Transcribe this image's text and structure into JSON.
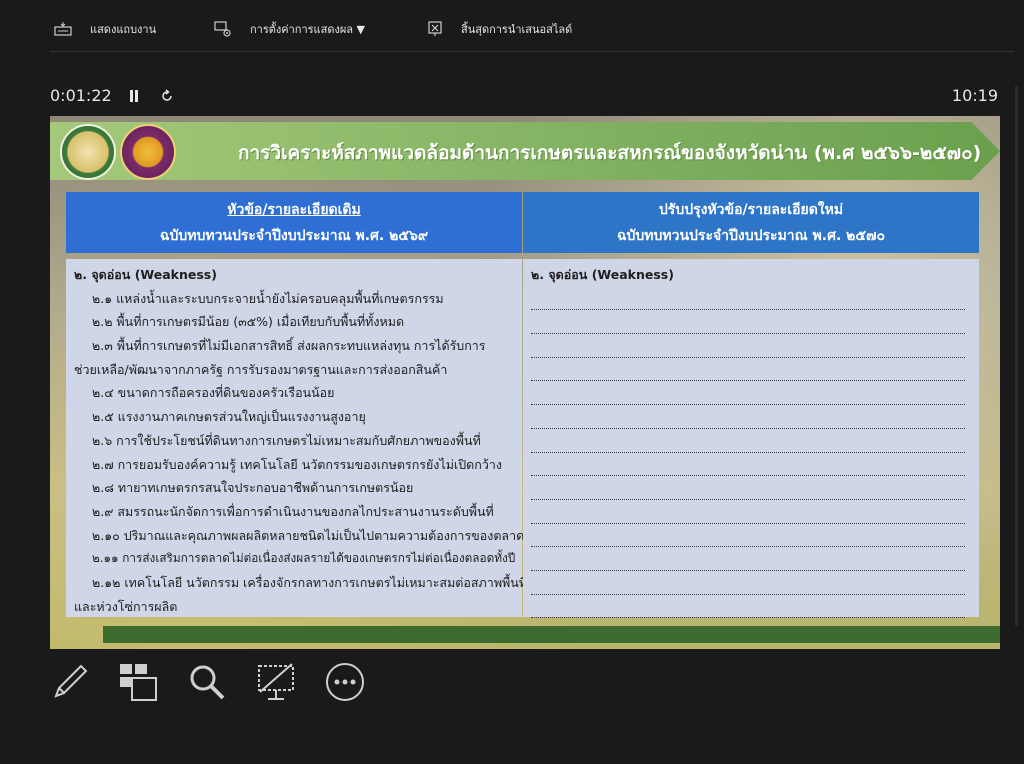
{
  "toolbar": {
    "show_taskbar": "แสดงแถบงาน",
    "display_settings": "การตั้งค่าการแสดงผล ▼",
    "end_slideshow": "สิ้นสุดการนำเสนอสไลด์"
  },
  "presenter": {
    "elapsed": "0:01:22",
    "clock": "10:19"
  },
  "slide": {
    "title": "การวิเคราะห์สภาพแวดล้อมด้านการเกษตรและสหกรณ์ของจังหวัดน่าน (พ.ศ ๒๕๖๖-๒๕๗๐)",
    "left": {
      "header_line1": "หัวข้อ/รายละเอียดเดิม",
      "header_line2": "ฉบับทบทวนประจำปีงบประมาณ พ.ศ. ๒๕๖๙",
      "lines": [
        "๒. จุดอ่อน (Weakness)",
        "๒.๑ แหล่งน้ำและระบบกระจายน้ำยังไม่ครอบคลุมพื้นที่เกษตรกรรม",
        "๒.๒ พื้นที่การเกษตรมีน้อย (๓๕%) เมื่อเทียบกับพื้นที่ทั้งหมด",
        "๒.๓ พื้นที่การเกษตรที่ไม่มีเอกสารสิทธิ์ ส่งผลกระทบแหล่งทุน การได้รับการ",
        "ช่วยเหลือ/พัฒนาจากภาครัฐ การรับรองมาตรฐานและการส่งออกสินค้า",
        "๒.๔ ขนาดการถือครองที่ดินของครัวเรือนน้อย",
        "๒.๕ แรงงานภาคเกษตรส่วนใหญ่เป็นแรงงานสูงอายุ",
        "๒.๖ การใช้ประโยชน์ที่ดินทางการเกษตรไม่เหมาะสมกับศักยภาพของพื้นที่",
        "๒.๗ การยอมรับองค์ความรู้ เทคโนโลยี นวัตกรรมของเกษตรกรยังไม่เปิดกว้าง",
        "๒.๘ ทายาทเกษตรกรสนใจประกอบอาชีพด้านการเกษตรน้อย",
        "๒.๙ สมรรถนะนักจัดการเพื่อการดำเนินงานของกลไกประสานงานระดับพื้นที่",
        "๒.๑๐ ปริมาณและคุณภาพผลผลิตหลายชนิดไม่เป็นไปตามความต้องการของตลาด",
        "๒.๑๑ การส่งเสริมการตลาดไม่ต่อเนื่องส่งผลรายได้ของเกษตรกรไม่ต่อเนื่องตลอดทั้งปี",
        "๒.๑๒ เทคโนโลยี นวัตกรรม เครื่องจักรกลทางการเกษตรไม่เหมาะสมต่อสภาพพื้นที่",
        "และห่วงโซ่การผลิต"
      ]
    },
    "right": {
      "header_line1": "ปรับปรุงหัวข้อ/รายละเอียดใหม่",
      "header_line2": "ฉบับทบทวนประจำปีงบประมาณ พ.ศ. ๒๕๗๐",
      "first_line": "๒. จุดอ่อน (Weakness)"
    }
  },
  "icons": {
    "taskbar": "taskbar-icon",
    "display": "display-settings-icon",
    "end": "end-slideshow-icon",
    "pause": "pause-icon",
    "restart": "restart-icon",
    "pen": "pen-icon",
    "slides": "see-all-slides-icon",
    "zoom": "zoom-icon",
    "black": "black-screen-icon",
    "more": "more-options-icon"
  },
  "colors": {
    "banner_green": "#7fb060",
    "header_blue": "#2f6fd3",
    "body_bg": "#cfd6e8",
    "footer_green": "#3b6b2f"
  }
}
